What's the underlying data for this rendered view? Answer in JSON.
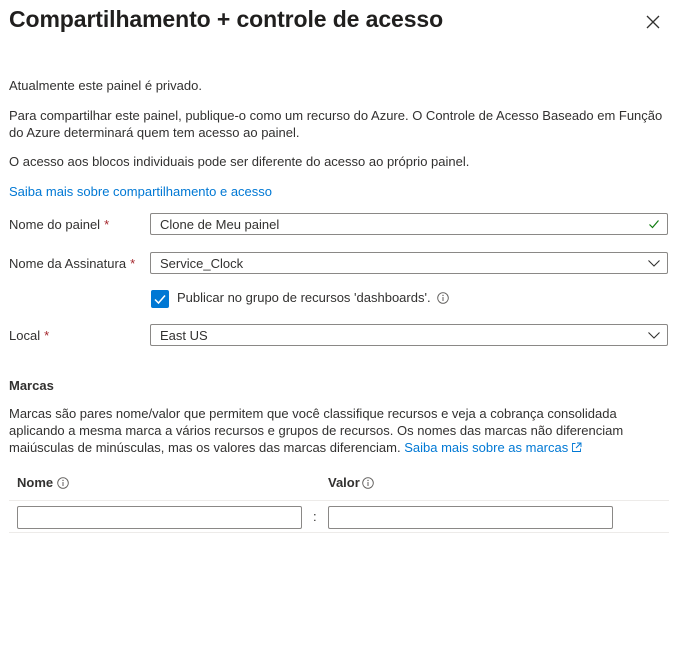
{
  "header": {
    "title": "Compartilhamento + controle de acesso",
    "close_icon": "close-icon"
  },
  "intro": {
    "private_text": "Atualmente este painel é privado.",
    "publish_text": "Para compartilhar este painel, publique-o como um recurso do Azure. O Controle de Acesso Baseado em Função do Azure determinará quem tem acesso ao painel.",
    "tiles_text": "O acesso aos blocos individuais pode ser diferente do acesso ao próprio painel.",
    "learn_more_link": "Saiba mais sobre compartilhamento e acesso"
  },
  "form": {
    "dashboard_name_label": "Nome do painel",
    "dashboard_name_value": "Clone de Meu painel",
    "subscription_label": "Nome da Assinatura",
    "subscription_value": "Service_Clock",
    "publish_checkbox_label": "Publicar no grupo de recursos 'dashboards'.",
    "publish_checked": true,
    "location_label": "Local",
    "location_value": "East US",
    "required_marker": "*"
  },
  "tags": {
    "title": "Marcas",
    "description": "Marcas são pares nome/valor que permitem que você classifique recursos e veja a cobrança consolidada aplicando a mesma marca a vários recursos e grupos de recursos. Os nomes das marcas não diferenciam maiúsculas de minúsculas, mas os valores das marcas diferenciam.",
    "learn_more_link": "Saiba mais sobre as marcas",
    "name_column": "Nome",
    "value_column": "Valor",
    "separator": ":",
    "name_value": "",
    "value_value": ""
  },
  "colors": {
    "accent": "#0078d4",
    "required": "#a4262c",
    "valid": "#107c10",
    "border": "#8a8886"
  }
}
